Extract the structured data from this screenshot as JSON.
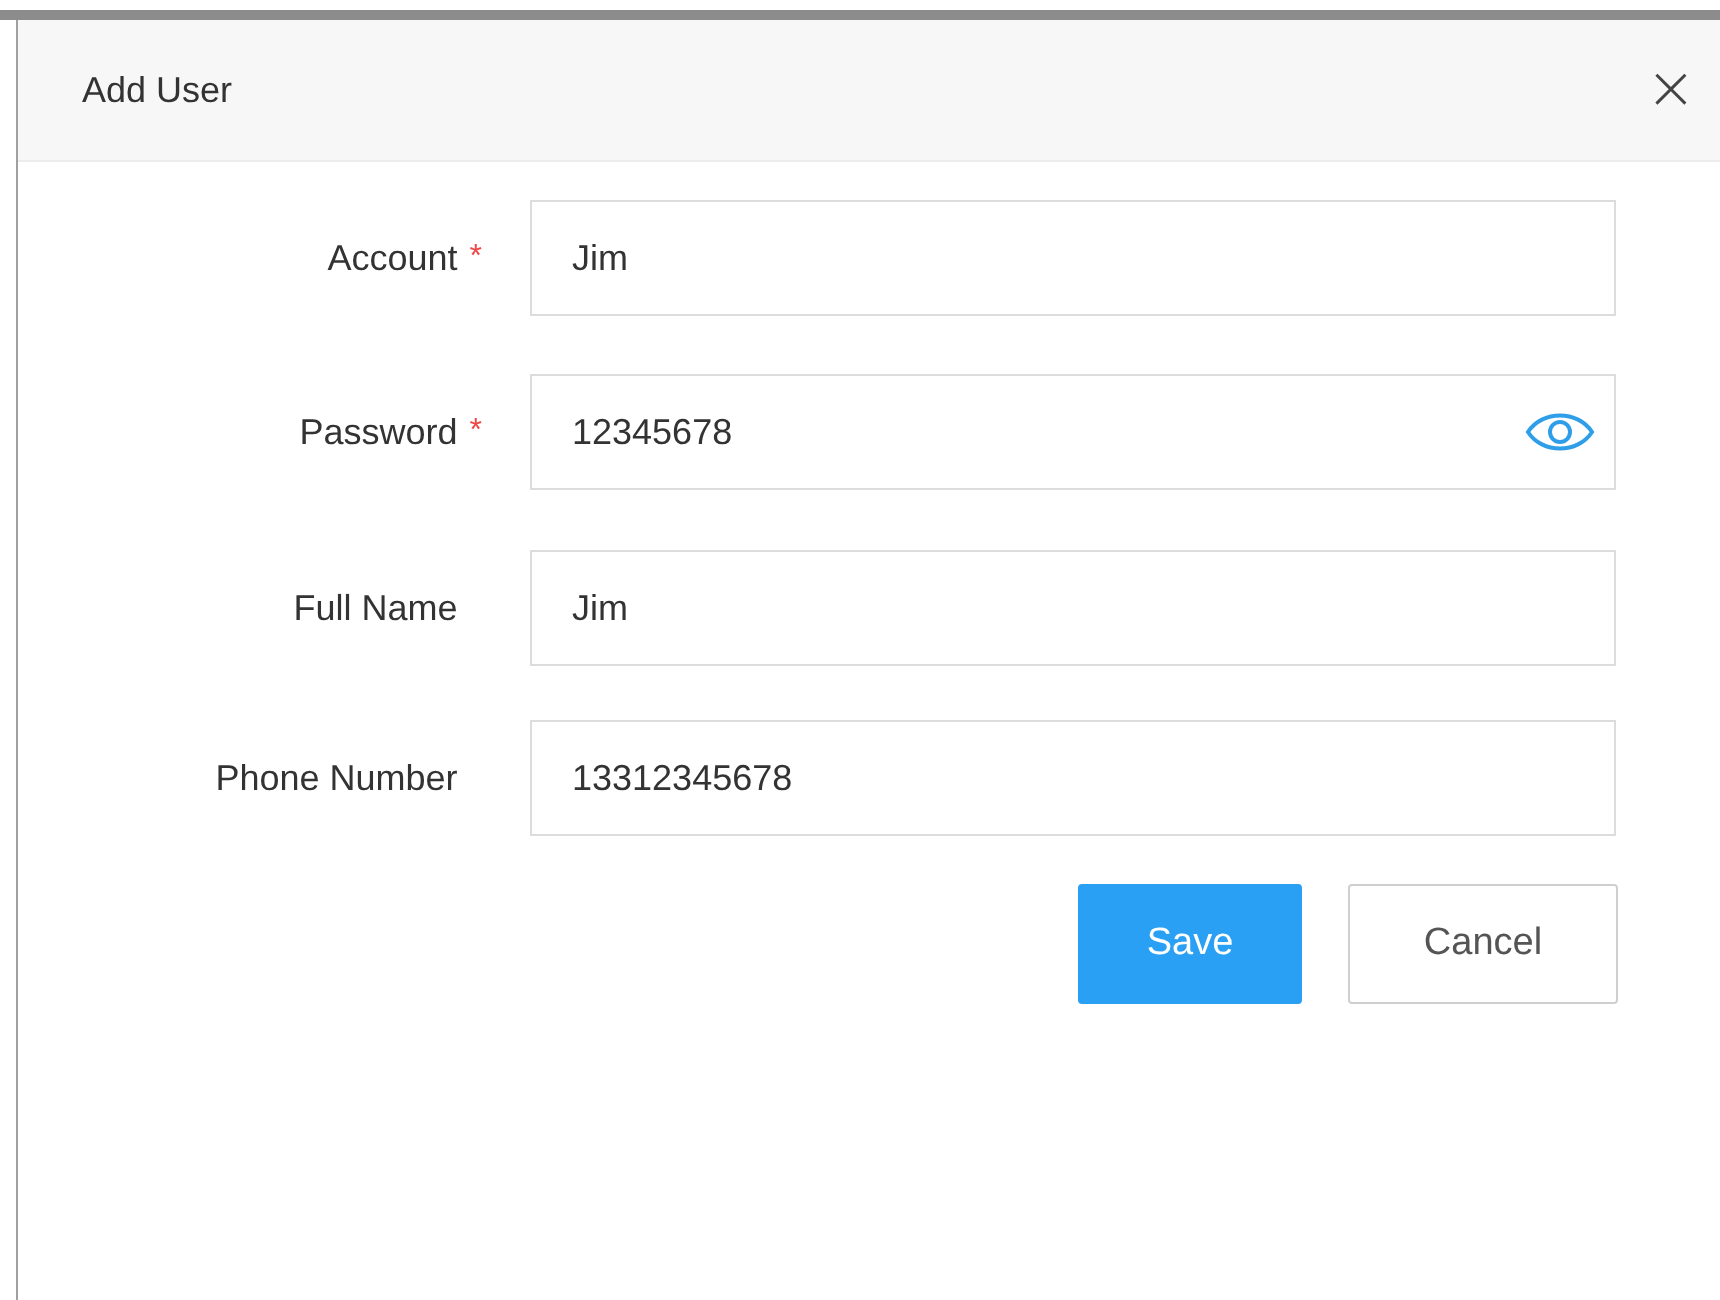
{
  "dialog": {
    "title": "Add User",
    "close": "×"
  },
  "fields": [
    {
      "label": "Account",
      "required": true,
      "kind": "text",
      "value": "Jim"
    },
    {
      "label": "Password",
      "required": true,
      "kind": "password",
      "value": "12345678"
    },
    {
      "label": "Full Name",
      "required": false,
      "kind": "text",
      "value": "Jim"
    },
    {
      "label": "Phone Number",
      "required": false,
      "kind": "text",
      "value": "13312345678"
    }
  ],
  "required_mark": "*",
  "buttons": [
    {
      "label": "Save",
      "kind": "primary"
    },
    {
      "label": "Cancel",
      "kind": "default"
    }
  ]
}
